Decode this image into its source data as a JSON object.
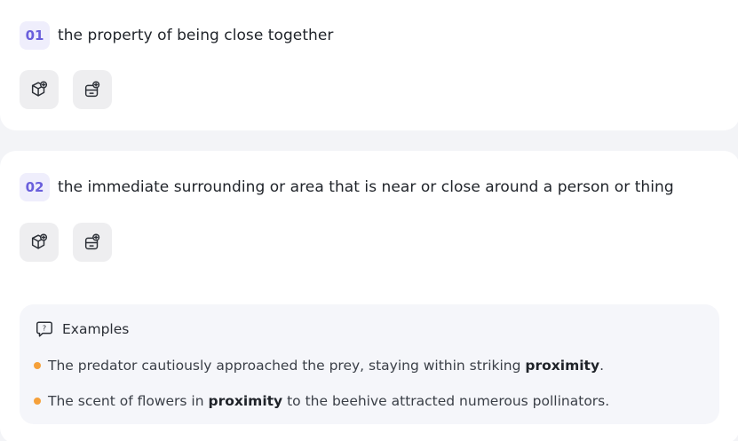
{
  "definitions": [
    {
      "number": "01",
      "text": "the property of being close together"
    },
    {
      "number": "02",
      "text": "the immediate surrounding or area that is near or close around a person or thing"
    }
  ],
  "actions": {
    "icon_1": "cube-plus-icon",
    "icon_2": "card-add-icon"
  },
  "examples": {
    "title": "Examples",
    "icon": "question-bubble-icon",
    "items": [
      {
        "before": "The predator cautiously approached the prey, staying within striking ",
        "keyword": "proximity",
        "after": "."
      },
      {
        "before": "The scent of flowers in ",
        "keyword": "proximity",
        "after": " to the beehive attracted numerous pollinators."
      }
    ]
  },
  "colors": {
    "badge_bg": "#efeefc",
    "badge_text": "#6a5fdc",
    "bullet": "#f5a03a"
  }
}
